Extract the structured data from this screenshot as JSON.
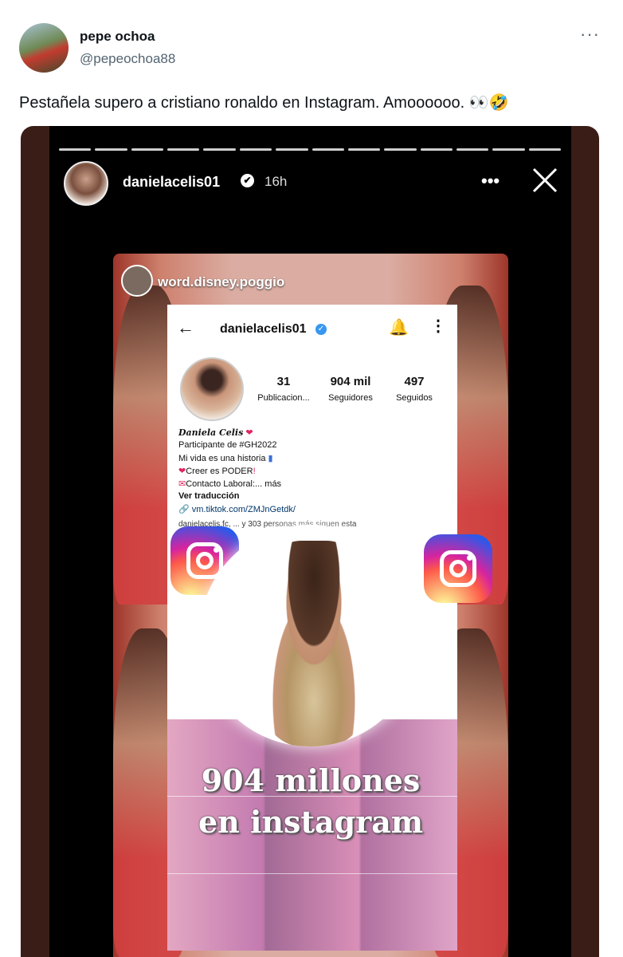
{
  "tweet": {
    "author_name": "pepe ochoa",
    "author_handle": "@pepeochoa88",
    "more_icon": "···",
    "text": "Pestañela supero a cristiano ronaldo en Instagram. Amoooooo. 👀🤣"
  },
  "story": {
    "username": "danielacelis01",
    "verified_icon": "✔",
    "time": "16h",
    "menu_icon": "•••",
    "repost_username": "word.disney.poggio"
  },
  "profile": {
    "username": "danielacelis01",
    "stats": [
      {
        "value": "31",
        "label": "Publicacion..."
      },
      {
        "value": "904 mil",
        "label": "Seguidores"
      },
      {
        "value": "497",
        "label": "Seguidos"
      }
    ],
    "bio_name": "Daniela Celis",
    "bio_lines": [
      "Participante de #GH2022",
      "Mi vida es una historia",
      "Creer es PODER",
      "Contacto Laboral:... más",
      "Ver traducción"
    ],
    "link": "vm.tiktok.com/ZMJnGetdk/",
    "followers_text": "danielacelis.fc, ... y 303 personas más siguen esta"
  },
  "overlay": {
    "caption_line1": "904 millones",
    "caption_line2": "en instagram"
  }
}
